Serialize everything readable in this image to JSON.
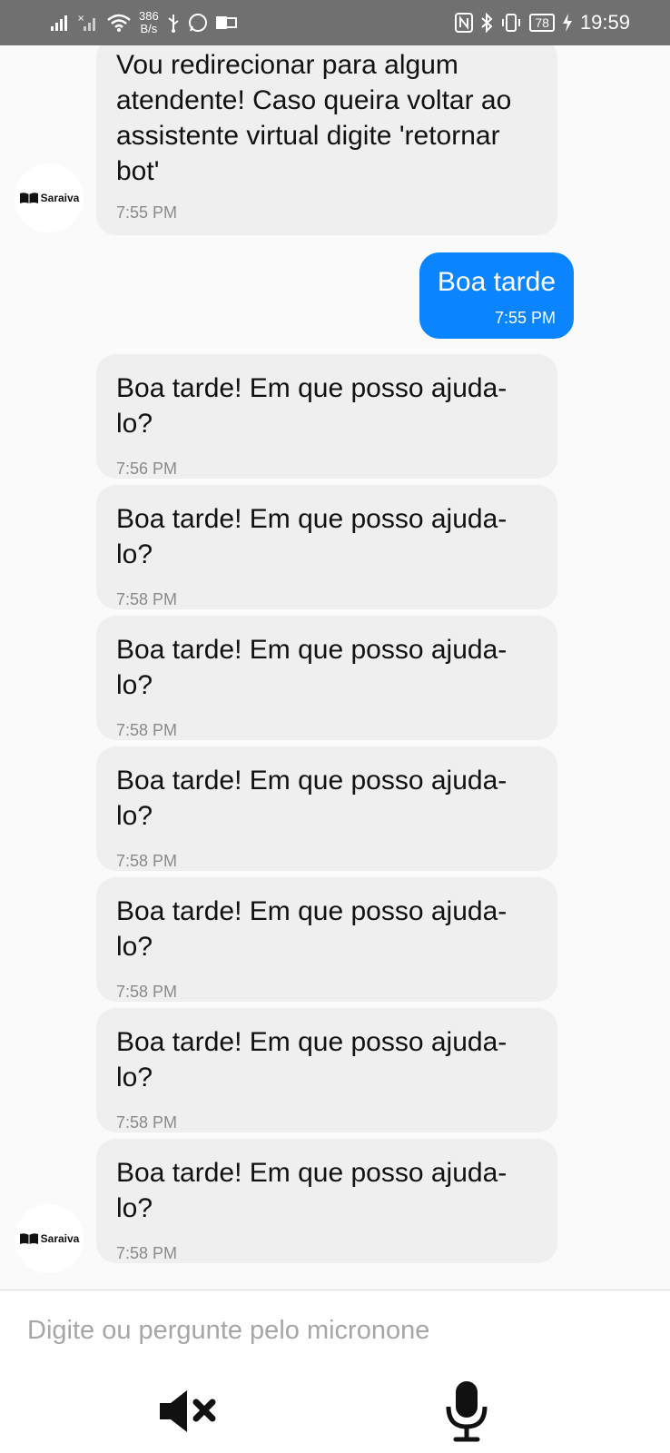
{
  "status_bar": {
    "speed_value": "386",
    "speed_unit": "B/s",
    "battery": "78",
    "time": "19:59",
    "icons": [
      "signal-icon",
      "signal-x-icon",
      "wifi-icon",
      "usb-icon",
      "whatsapp-icon",
      "outlook-icon",
      "nfc-icon",
      "bluetooth-icon",
      "vibrate-icon",
      "battery-icon",
      "charging-icon"
    ]
  },
  "bot": {
    "avatar_label": "Saraiva"
  },
  "messages": [
    {
      "from": "bot",
      "text": "Vou redirecionar para algum atendente! Caso queira voltar ao assistente virtual digite 'retornar bot'",
      "time": "7:55 PM"
    },
    {
      "from": "user",
      "text": "Boa tarde",
      "time": "7:55 PM"
    },
    {
      "from": "bot",
      "text": "Boa tarde! Em que posso ajuda-lo?",
      "time": "7:56 PM"
    },
    {
      "from": "bot",
      "text": "Boa tarde! Em que posso ajuda-lo?",
      "time": "7:58 PM"
    },
    {
      "from": "bot",
      "text": "Boa tarde! Em que posso ajuda-lo?",
      "time": "7:58 PM"
    },
    {
      "from": "bot",
      "text": "Boa tarde! Em que posso ajuda-lo?",
      "time": "7:58 PM"
    },
    {
      "from": "bot",
      "text": "Boa tarde! Em que posso ajuda-lo?",
      "time": "7:58 PM"
    },
    {
      "from": "bot",
      "text": "Boa tarde! Em que posso ajuda-lo?",
      "time": "7:58 PM"
    },
    {
      "from": "bot",
      "text": "Boa tarde! Em que posso ajuda-lo?",
      "time": "7:58 PM"
    }
  ],
  "input": {
    "placeholder": "Digite ou pergunte pelo micronone",
    "value": ""
  },
  "controls": {
    "mute_icon": "speaker-mute-icon",
    "mic_icon": "microphone-icon"
  },
  "colors": {
    "user_bubble": "#0a84ff",
    "bot_bubble": "#efefef",
    "status_bar": "#707070"
  }
}
